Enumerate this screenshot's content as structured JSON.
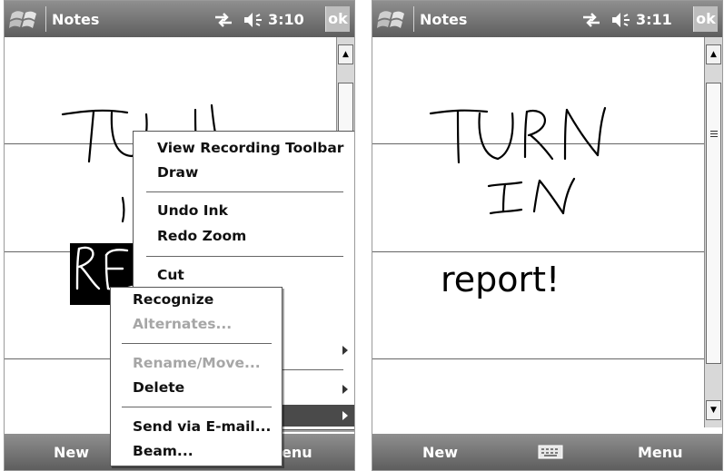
{
  "left_screen": {
    "title": "Notes",
    "clock": "3:10",
    "ok_label": "ok",
    "softkeys": {
      "left": "New",
      "right": "Menu",
      "right_visible": "enu"
    },
    "ink_text": "TURN IN RE",
    "context_menu": {
      "items": [
        "View Recording Toolbar",
        "Draw",
        "Undo Ink",
        "Redo Zoom",
        "Cut"
      ]
    },
    "sub_menu": {
      "items": [
        {
          "label": "Recognize",
          "enabled": true
        },
        {
          "label": "Alternates...",
          "enabled": false
        },
        {
          "label": "Rename/Move...",
          "enabled": false
        },
        {
          "label": "Delete",
          "enabled": true
        },
        {
          "label": "Send via E-mail...",
          "enabled": true
        },
        {
          "label": "Beam...",
          "enabled": true
        }
      ]
    }
  },
  "right_screen": {
    "title": "Notes",
    "clock": "3:11",
    "ok_label": "ok",
    "softkeys": {
      "left": "New",
      "right": "Menu"
    },
    "ink_text": "TURN IN",
    "recognized_text": "report!"
  },
  "colors": {
    "bar_top": "#8f8f8f",
    "bar_bottom": "#5e5e5e",
    "selection": "#000000"
  },
  "icons": [
    "windows-logo-icon",
    "connectivity-icon",
    "speaker-icon",
    "keyboard-icon",
    "scroll-up-icon",
    "scroll-down-icon",
    "submenu-arrow-icon"
  ]
}
